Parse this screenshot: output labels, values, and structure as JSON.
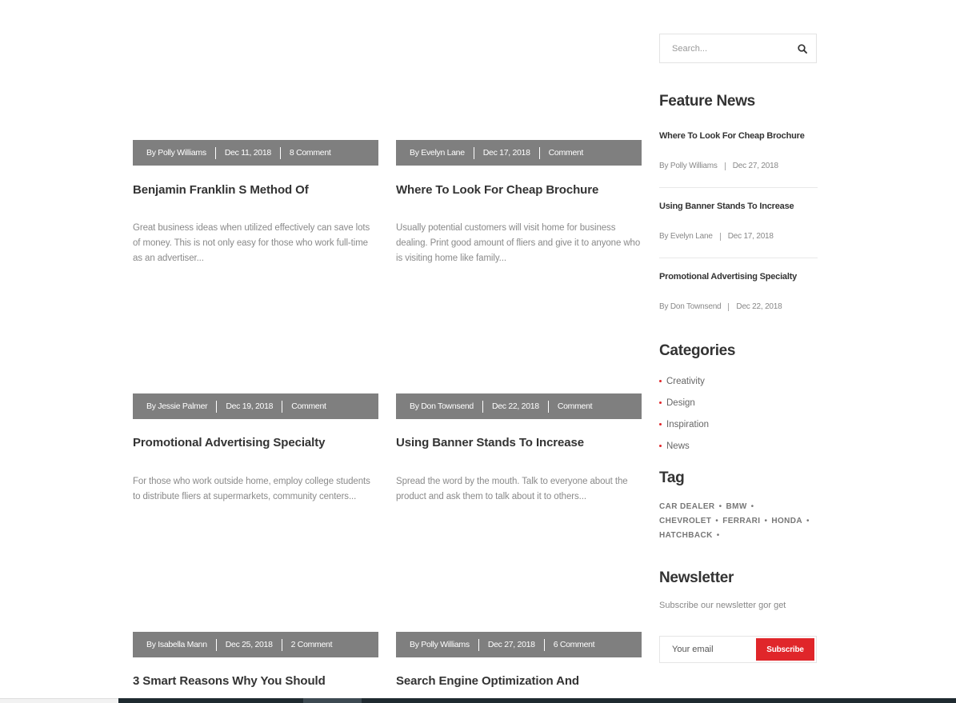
{
  "posts": [
    {
      "author": "By Polly Williams",
      "date": "Dec 11, 2018",
      "comments": "8 Comment",
      "title": "Benjamin Franklin S Method Of",
      "excerpt": "Great business ideas when utilized effectively can save lots of money. This is not only easy for those who work full-time as an advertiser..."
    },
    {
      "author": "By Evelyn Lane",
      "date": "Dec 17, 2018",
      "comments": "Comment",
      "title": "Where To Look For Cheap Brochure",
      "excerpt": "Usually potential customers will visit home for business dealing. Print good amount of fliers and give it to anyone who is visiting home like family..."
    },
    {
      "author": "By Jessie Palmer",
      "date": "Dec 19, 2018",
      "comments": "Comment",
      "title": "Promotional Advertising Specialty",
      "excerpt": "For those who work outside home, employ college students to distribute fliers at supermarkets, community centers..."
    },
    {
      "author": "By Don Townsend",
      "date": "Dec 22, 2018",
      "comments": "Comment",
      "title": "Using Banner Stands To Increase",
      "excerpt": "Spread the word by the mouth. Talk to everyone about the product and ask them to talk about it to others..."
    },
    {
      "author": "By Isabella Mann",
      "date": "Dec 25, 2018",
      "comments": "2 Comment",
      "title": "3 Smart Reasons Why You Should",
      "excerpt": ""
    },
    {
      "author": "By Polly Williams",
      "date": "Dec 27, 2018",
      "comments": "6 Comment",
      "title": "Search Engine Optimization And",
      "excerpt": ""
    }
  ],
  "sidebar": {
    "search": {
      "placeholder": "Search...",
      "icon": "search-icon"
    },
    "feature_title": "Feature News",
    "feature": [
      {
        "title": "Where To Look For Cheap Brochure",
        "author": "By Polly Williams",
        "date": "Dec 27, 2018"
      },
      {
        "title": "Using Banner Stands To Increase",
        "author": "By Evelyn Lane",
        "date": "Dec 17, 2018"
      },
      {
        "title": "Promotional Advertising Specialty",
        "author": "By Don Townsend",
        "date": "Dec 22, 2018"
      }
    ],
    "categories_title": "Categories",
    "categories": [
      "Creativity",
      "Design",
      "Inspiration",
      "News"
    ],
    "tag_title": "Tag",
    "tags": [
      "CAR DEALER",
      "BMW",
      "CHEVROLET",
      "FERRARI",
      "HONDA",
      "HATCHBACK"
    ],
    "newsletter_title": "Newsletter",
    "newsletter_sub": "Subscribe our newsletter gor get",
    "email_placeholder": "Your email",
    "subscribe_label": "Subscribe"
  },
  "colors": {
    "meta_bar": "#7f7f7f",
    "accent": "#e0262a",
    "text": "#333333",
    "muted": "#8a8a8a"
  }
}
